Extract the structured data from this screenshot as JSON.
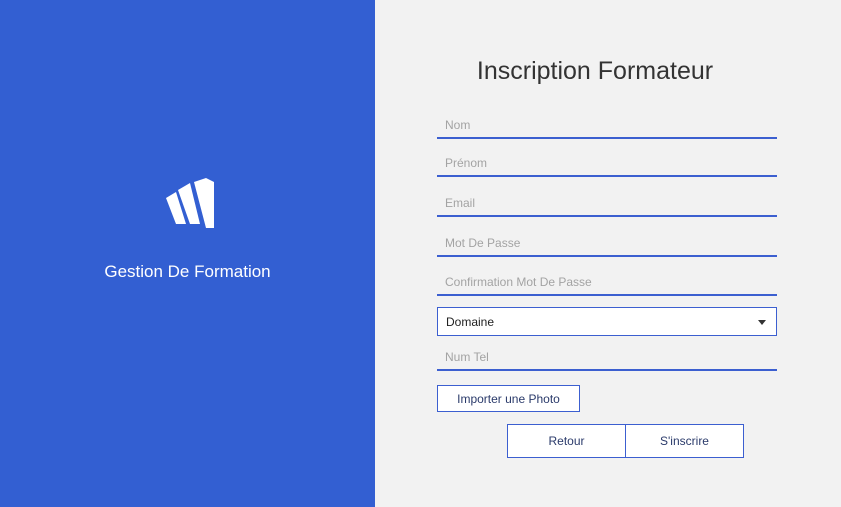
{
  "sidebar": {
    "app_name": "Gestion De Formation",
    "background_color": "#335fd2",
    "logo_icon": "app-logo-icon"
  },
  "form": {
    "title": "Inscription Formateur",
    "accent_color": "#3c5fd0",
    "fields": {
      "nom": {
        "placeholder": "Nom",
        "value": ""
      },
      "prenom": {
        "placeholder": "Prénom",
        "value": ""
      },
      "email": {
        "placeholder": "Email",
        "value": ""
      },
      "password": {
        "placeholder": "Mot De Passe",
        "value": ""
      },
      "password_confirm": {
        "placeholder": "Confirmation Mot De Passe",
        "value": ""
      },
      "domaine": {
        "selected": "Domaine"
      },
      "num_tel": {
        "placeholder": "Num Tel",
        "value": ""
      }
    },
    "buttons": {
      "import_photo": "Importer une Photo",
      "retour": "Retour",
      "inscrire": "S'inscrire"
    }
  }
}
